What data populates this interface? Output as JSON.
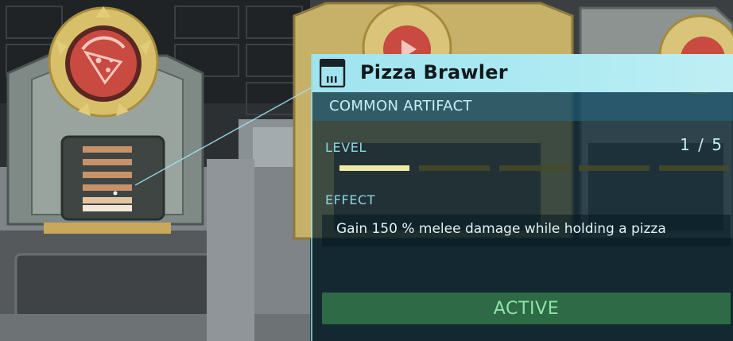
{
  "tooltip": {
    "title": "Pizza Brawler",
    "rarity": "COMMON ARTIFACT",
    "level_label": "LEVEL",
    "level_value": "1 / 5",
    "level_current": 1,
    "level_max": 5,
    "effect_label": "EFFECT",
    "effect_text": "Gain 150 % melee damage while holding a pizza",
    "status_button": "ACTIVE",
    "icon": "artifact-card-icon"
  },
  "scene": {
    "selected_artifact_icon": "pizza-icon",
    "neighbor_artifact_icon": "play-icon"
  },
  "colors": {
    "header_bg": "#aeeaf2",
    "rarity_bg": "#184e66",
    "level_fill": "#eee9a3",
    "active_button": "#2d6a45",
    "active_text": "#8fe4a6",
    "gold_ring": "#d8c06a",
    "emblem_red": "#c84a40"
  }
}
